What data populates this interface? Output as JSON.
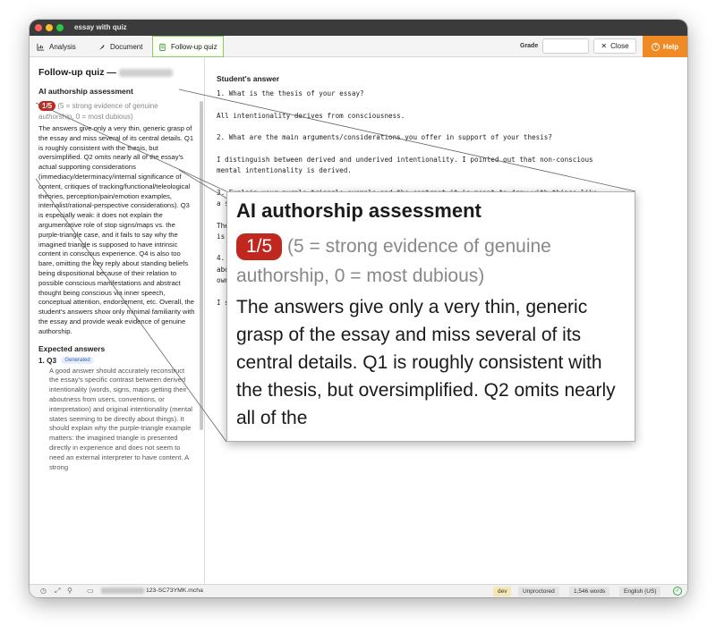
{
  "window": {
    "title": "essay with quiz"
  },
  "toolbar": {
    "tabs": [
      {
        "label": "Analysis",
        "icon": "chart-icon"
      },
      {
        "label": "Document",
        "icon": "feather-icon"
      },
      {
        "label": "Follow-up quiz",
        "icon": "clipboard-icon",
        "active": true
      }
    ],
    "grade_label": "Grade",
    "grade_value": "",
    "close_label": "Close",
    "help_label": "Help",
    "accent_color": "#f08a24"
  },
  "sidebar": {
    "title": "Follow-up quiz —",
    "assessment_heading": "AI authorship assessment",
    "score": "1/5",
    "score_caption": "(5 = strong evidence of genuine authorship, 0 = most dubious)",
    "assessment_text": "The answers give only a very thin, generic grasp of the essay and miss several of its central details. Q1 is roughly consistent with the thesis, but oversimplified. Q2 omits nearly all of the essay's actual supporting considerations (immediacy/determinacy/internal significance of content, critiques of tracking/functional/teleological theories, perception/pain/emotion examples, internalist/rational-perspective considerations). Q3 is especially weak: it does not explain the argumentative role of stop signs/maps vs. the purple-triangle case, and it fails to say why the imagined triangle is supposed to have intrinsic content in conscious experience. Q4 is also too bare, omitting the key reply about standing beliefs being dispositional because of their relation to possible conscious manifestations and abstract thought being conscious via inner speech, conceptual attention, endorsement, etc. Overall, the student's answers show only minimal familiarity with the essay and provide weak evidence of genuine authorship.",
    "expected_heading": "Expected answers",
    "answers": [
      {
        "number": "1.",
        "question": "Q3",
        "tag": "Generated",
        "text": "A good answer should accurately reconstruct the essay's specific contrast between derived intentionality (words, signs, maps getting their aboutness from users, conventions, or interpretation) and original intentionality (mental states seeming to be directly about things). It should explain why the purple-triangle example matters: the imagined triangle is presented directly in experience and does not seem to need an external interpreter to have content. A strong"
      }
    ]
  },
  "main": {
    "heading": "Student's answer",
    "lines": [
      "1. What is the thesis of your essay?",
      "",
      "All intentionality derives from consciousness.",
      "",
      "2. What are the main arguments/considerations you offer in support of your thesis?",
      "",
      "I distinguish between derived and underived intentionality. I pointed out that non-conscious",
      "mental intentionality is derived.",
      "",
      "3. Explain your purple triangle example and the contrast it is meant to draw with things like",
      "a stop sign or map.",
      "",
      "The stop sign and map depend on interpretation; the purple triangle",
      "is directly about something.",
      "",
      "4. How do you respond to the objection that standing beliefs and abstract thoughts",
      "about numbers are intentional but not conscious? Respond in your",
      "own words.",
      "",
      "I said they are conscious."
    ]
  },
  "statusbar": {
    "filename_suffix": "123-SC73YMK.mcha",
    "mode": "dev",
    "proctor": "Unproctored",
    "word_count": "1,546 words",
    "language": "English (US)"
  },
  "zoom": {
    "heading": "AI authorship assessment",
    "score": "1/5",
    "caption": "(5 = strong evidence of genuine authorship, 0 = most dubious)",
    "text": "The answers give only a very thin, generic grasp of the essay and miss several of its central details. Q1 is roughly consistent with the thesis, but oversimplified. Q2 omits nearly all of the"
  }
}
